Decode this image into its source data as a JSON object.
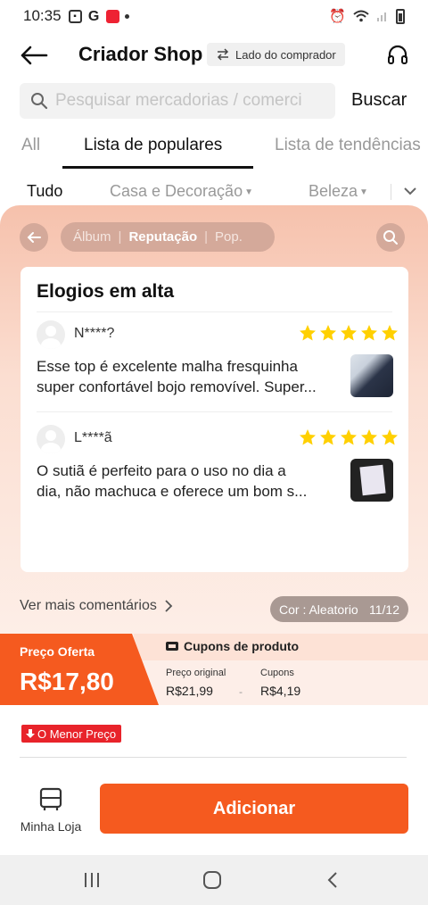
{
  "status_bar": {
    "time": "10:35"
  },
  "header": {
    "title": "Criador Shop",
    "mode_label": "Lado do comprador"
  },
  "search": {
    "placeholder": "Pesquisar mercadorias / comerci",
    "button": "Buscar"
  },
  "tabs": [
    {
      "label": "All"
    },
    {
      "label": "Lista de populares",
      "active": true
    },
    {
      "label": "Lista de tendências"
    }
  ],
  "categories": [
    {
      "label": "Tudo",
      "active": true
    },
    {
      "label": "Casa e Decoração"
    },
    {
      "label": "Beleza"
    }
  ],
  "panel": {
    "segments": [
      {
        "label": "Álbum"
      },
      {
        "label": "Reputação",
        "active": true
      },
      {
        "label": "Pop."
      }
    ],
    "card_title": "Elogios em alta",
    "reviews": [
      {
        "name": "N****?",
        "rating": 5,
        "text_line1": "Esse top é excelente malha fresquinha",
        "text_line2": "super confortável bojo removível. Super..."
      },
      {
        "name": "L****ã",
        "rating": 5,
        "text_line1": "O sutiã é perfeito para o uso no dia a",
        "text_line2": "dia, não machuca e oferece um bom s..."
      }
    ],
    "more_comments": "Ver mais comentários",
    "color_chip": {
      "label": "Cor : Aleatorio",
      "counter": "11/12"
    }
  },
  "price": {
    "offer_label": "Preço Oferta",
    "offer_value": "R$17,80",
    "coupons_title": "Cupons de produto",
    "original_label": "Preço original",
    "original_value": "R$21,99",
    "minus": "-",
    "coupon_label": "Cupons",
    "coupon_value": "R$4,19"
  },
  "badge": {
    "lowest_price": "O Menor Preço"
  },
  "bottom": {
    "my_store": "Minha Loja",
    "add_button": "Adicionar"
  },
  "colors": {
    "accent": "#f55a1f",
    "badge_red": "#e8232a",
    "star": "#ffd000"
  }
}
